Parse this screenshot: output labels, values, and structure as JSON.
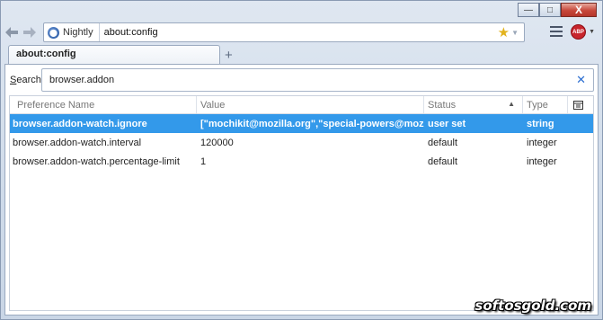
{
  "window": {
    "controls": {
      "minimize": "—",
      "maximize": "□",
      "close": "X"
    }
  },
  "navbar": {
    "back_icon": "back-arrow-icon",
    "forward_icon": "forward-arrow-icon",
    "identity_label": "Nightly",
    "url": "about:config"
  },
  "tabs": [
    {
      "label": "about:config"
    }
  ],
  "newtab_symbol": "+",
  "search": {
    "label_prefix": "S",
    "label_rest": "earch:",
    "value": "browser.addon"
  },
  "table": {
    "columns": [
      "Preference Name",
      "Value",
      "Status",
      "Type"
    ],
    "sorted_column": "Status",
    "rows": [
      {
        "name": "browser.addon-watch.ignore",
        "value": "[\"mochikit@mozilla.org\",\"special-powers@mozilla....",
        "status": "user set",
        "type": "string",
        "selected": true
      },
      {
        "name": "browser.addon-watch.interval",
        "value": "120000",
        "status": "default",
        "type": "integer",
        "selected": false
      },
      {
        "name": "browser.addon-watch.percentage-limit",
        "value": "1",
        "status": "default",
        "type": "integer",
        "selected": false
      }
    ]
  },
  "watermark": "softosgold.com",
  "colors": {
    "selection": "#3399ea",
    "close_button": "#c7473a",
    "abp": "#c8252c"
  }
}
